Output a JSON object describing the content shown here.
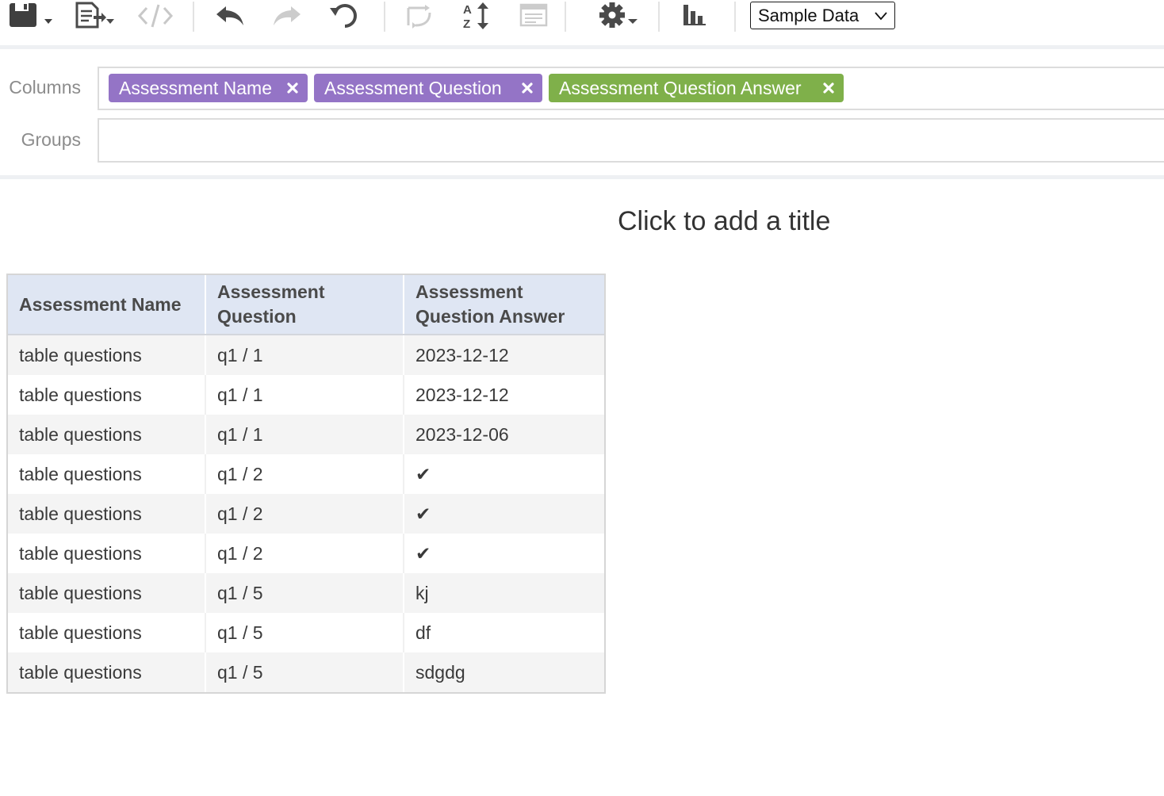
{
  "toolbar": {
    "icons": [
      "save-icon",
      "export-icon",
      "code-icon",
      "undo-icon",
      "redo-icon",
      "reset-icon",
      "swap-axes-icon",
      "sort-icon",
      "subtotals-icon",
      "settings-icon",
      "chart-icon"
    ],
    "dataset_selector": "Sample Data"
  },
  "config": {
    "columns_label": "Columns",
    "groups_label": "Groups",
    "columns": [
      {
        "label": "Assessment Name",
        "color": "#9474c6"
      },
      {
        "label": "Assessment Question",
        "color": "#9474c6"
      },
      {
        "label": "Assessment Question Answer",
        "color": "#7fb04a"
      }
    ]
  },
  "report": {
    "title": "Click to add a title"
  },
  "table": {
    "headers": [
      "Assessment Name",
      "Assessment Question",
      "Assessment Question Answer"
    ],
    "rows": [
      [
        "table questions",
        "q1 / 1",
        "2023-12-12"
      ],
      [
        "table questions",
        "q1 / 1",
        "2023-12-12"
      ],
      [
        "table questions",
        "q1 / 1",
        "2023-12-06"
      ],
      [
        "table questions",
        "q1 / 2",
        "✔"
      ],
      [
        "table questions",
        "q1 / 2",
        "✔"
      ],
      [
        "table questions",
        "q1 / 2",
        "✔"
      ],
      [
        "table questions",
        "q1 / 5",
        "kj"
      ],
      [
        "table questions",
        "q1 / 5",
        "df"
      ],
      [
        "table questions",
        "q1 / 5",
        "sdgdg"
      ]
    ]
  }
}
